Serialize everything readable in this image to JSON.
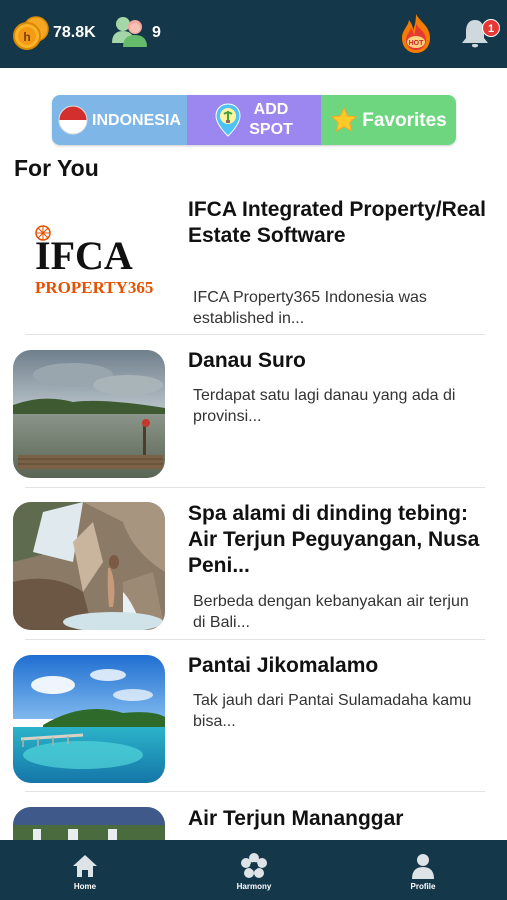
{
  "header": {
    "coins": "78.8K",
    "friends": "9",
    "notification_count": "1"
  },
  "segments": {
    "indonesia": "INDONESIA",
    "add_spot_line1": "ADD",
    "add_spot_line2": "SPOT",
    "favorites": "Favorites"
  },
  "section_title": "For You",
  "items": [
    {
      "title": "IFCA Integrated Property/Real Estate Software",
      "desc": "IFCA Property365 Indonesia was established in...",
      "logo_main": "IFCA",
      "logo_sub": "PROPERTY365"
    },
    {
      "title": "Danau Suro",
      "desc": "Terdapat satu lagi danau yang ada di provinsi..."
    },
    {
      "title": "Spa alami di dinding tebing: Air Terjun Peguyangan, Nusa Peni...",
      "desc": "Berbeda dengan kebanyakan air terjun di Bali..."
    },
    {
      "title": "Pantai Jikomalamo",
      "desc": "Tak jauh dari Pantai Sulamadaha kamu bisa..."
    },
    {
      "title": "Air Terjun Mananggar",
      "desc": ""
    }
  ],
  "nav": {
    "home": "Home",
    "harmony": "Harmony",
    "profile": "Profile"
  },
  "colors": {
    "topbar": "#14384a",
    "indonesia_btn": "#7fb6e8",
    "add_spot_btn": "#9c86f0",
    "favorites_btn": "#6dd67f",
    "badge": "#e53935"
  },
  "icons": {
    "coins": "coin-icon",
    "friends": "friends-icon",
    "hot": "hot-flame-icon",
    "notifications": "bell-icon",
    "indonesia": "indonesia-flag-icon",
    "add_spot": "map-pin-icon",
    "favorites": "star-icon",
    "home": "home-icon",
    "harmony": "flower-icon",
    "profile": "person-icon"
  }
}
